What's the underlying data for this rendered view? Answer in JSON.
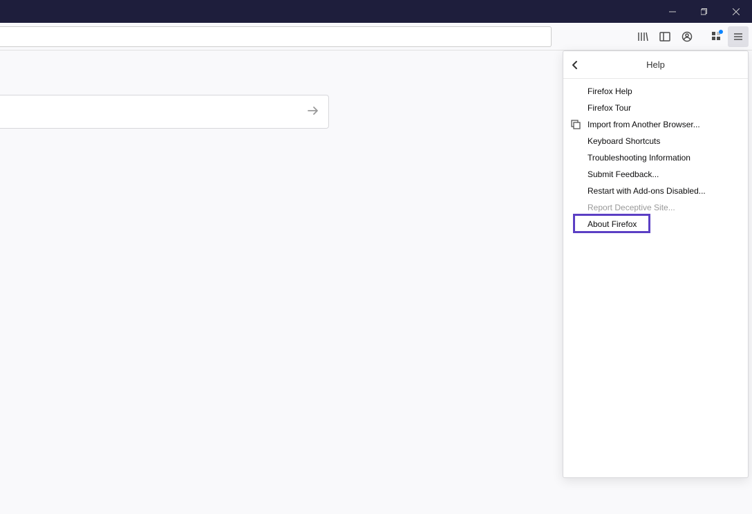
{
  "panel": {
    "title": "Help",
    "items": [
      {
        "label": "Firefox Help",
        "icon": null,
        "disabled": false
      },
      {
        "label": "Firefox Tour",
        "icon": null,
        "disabled": false
      },
      {
        "label": "Import from Another Browser...",
        "icon": "import",
        "disabled": false
      },
      {
        "label": "Keyboard Shortcuts",
        "icon": null,
        "disabled": false
      },
      {
        "label": "Troubleshooting Information",
        "icon": null,
        "disabled": false
      },
      {
        "label": "Submit Feedback...",
        "icon": null,
        "disabled": false
      },
      {
        "label": "Restart with Add-ons Disabled...",
        "icon": null,
        "disabled": false
      },
      {
        "label": "Report Deceptive Site...",
        "icon": null,
        "disabled": true
      },
      {
        "label": "About Firefox",
        "icon": null,
        "disabled": false
      }
    ]
  },
  "highlighted_item_index": 8
}
